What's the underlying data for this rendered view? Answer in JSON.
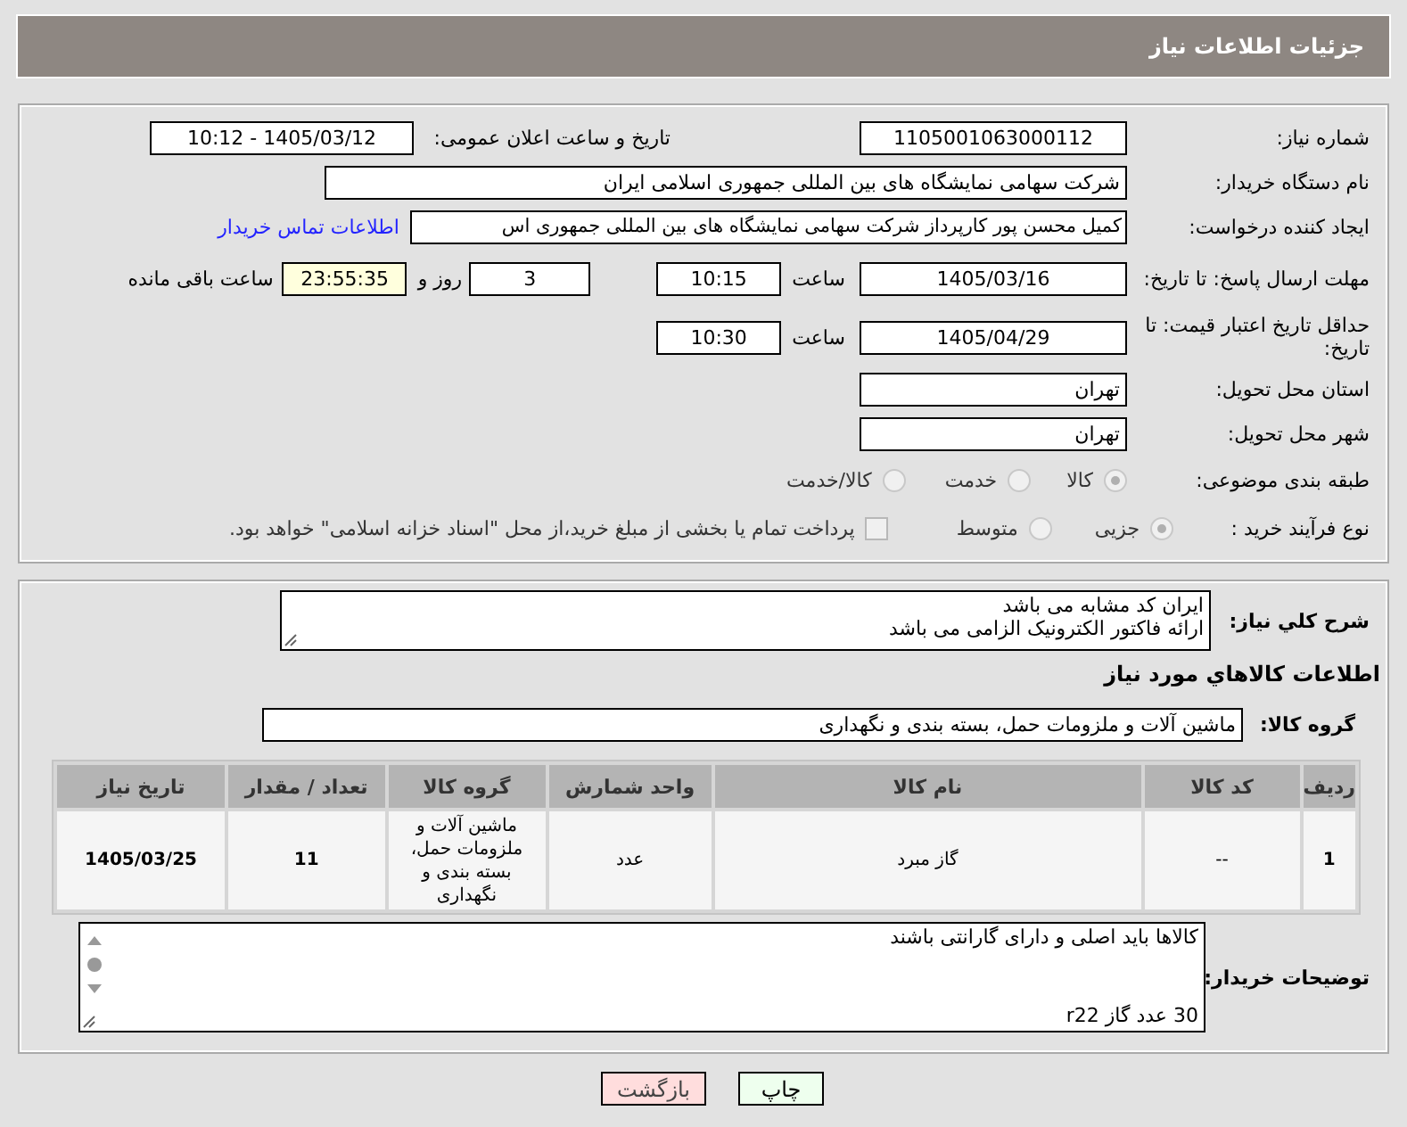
{
  "header": {
    "title": "جزئیات اطلاعات نیاز"
  },
  "need_number": {
    "label": "شماره نیاز:",
    "value": "1105001063000112"
  },
  "announce": {
    "label": "تاریخ و ساعت اعلان عمومی:",
    "value": "1405/03/12 - 10:12"
  },
  "buyer_org": {
    "label": "نام دستگاه خریدار:",
    "value": "شرکت سهامی نمایشگاه های بین المللی جمهوری اسلامی ایران"
  },
  "requester": {
    "label": "ایجاد کننده درخواست:",
    "value": "کمیل محسن پور کارپرداز شرکت سهامی نمایشگاه های بین المللی جمهوری اس",
    "link": "اطلاعات تماس خریدار"
  },
  "reply_deadline": {
    "label": "مهلت ارسال پاسخ: تا تاریخ:",
    "date": "1405/03/16",
    "time_label": "ساعت",
    "time": "10:15",
    "days": "3",
    "days_label": "روز و",
    "remaining": "23:55:35",
    "remaining_label": "ساعت باقی مانده"
  },
  "price_validity": {
    "label": "حداقل تاریخ اعتبار قیمت: تا تاریخ:",
    "date": "1405/04/29",
    "time_label": "ساعت",
    "time": "10:30"
  },
  "province": {
    "label": "استان محل تحویل:",
    "value": "تهران"
  },
  "city": {
    "label": "شهر محل تحویل:",
    "value": "تهران"
  },
  "category": {
    "label": "طبقه بندی موضوعی:",
    "options": [
      {
        "label": "کالا",
        "selected": true
      },
      {
        "label": "خدمت",
        "selected": false
      },
      {
        "label": "کالا/خدمت",
        "selected": false
      }
    ]
  },
  "process": {
    "label": "نوع فرآیند خرید :",
    "options": [
      {
        "label": "جزیی",
        "selected": true
      },
      {
        "label": "متوسط",
        "selected": false
      }
    ],
    "payment": {
      "label": "پرداخت تمام یا بخشی از مبلغ خرید،از محل \"اسناد خزانه اسلامی\" خواهد بود.",
      "checked": false
    }
  },
  "description": {
    "label": "شرح کلي نياز:",
    "lines": [
      "ایران کد مشابه می باشد",
      "ارائه فاکتور الکترونیک الزامی می باشد"
    ]
  },
  "items_heading": "اطلاعات کالاهاي مورد نياز",
  "goods_group": {
    "label": "گروه کالا:",
    "value": "ماشین آلات و ملزومات حمل، بسته بندی و نگهداری"
  },
  "table": {
    "columns": [
      "ردیف",
      "کد کالا",
      "نام کالا",
      "واحد شمارش",
      "گروه کالا",
      "تعداد / مقدار",
      "تاریخ نیاز"
    ],
    "rows": [
      [
        "1",
        "--",
        "گاز مبرد",
        "عدد",
        "ماشین آلات و ملزومات حمل، بسته بندی و نگهداری",
        "11",
        "1405/03/25"
      ]
    ]
  },
  "buyer_notes": {
    "label": "توضیحات خریدار:",
    "lines": [
      "کالاها باید اصلی و دارای گارانتی باشند",
      "30 عدد گاز r22"
    ]
  },
  "buttons": [
    {
      "label": "چاپ",
      "kind": "print"
    },
    {
      "label": "بازگشت",
      "kind": "back"
    }
  ]
}
